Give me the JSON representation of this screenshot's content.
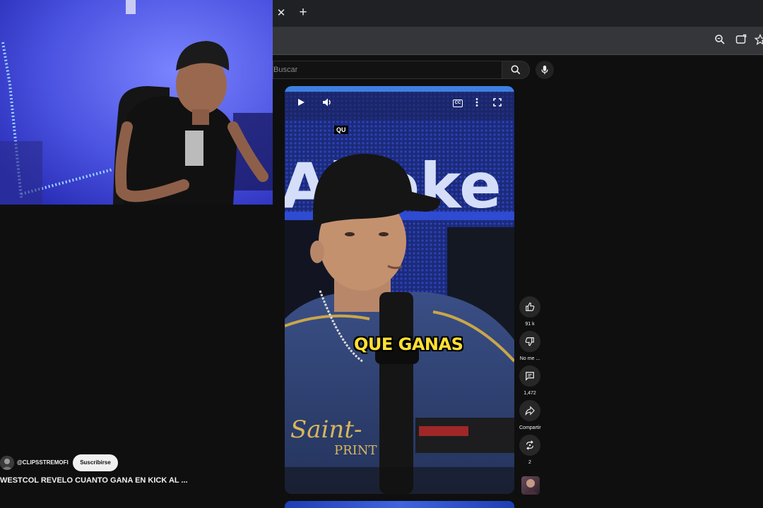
{
  "browser": {
    "tab_close_glyph": "✕",
    "new_tab_glyph": "+"
  },
  "search": {
    "placeholder": "Buscar"
  },
  "short": {
    "top_overlay_text": "QU",
    "caption": "QUE GANAS"
  },
  "actions": {
    "like_count": "91 k",
    "dislike_label": "No me ...",
    "comment_count": "1,472",
    "share_label": "Compartir",
    "remix_count": "2"
  },
  "channel": {
    "name": "@CLIPSSTREMOFI",
    "subscribe_label": "Suscribirse"
  },
  "video": {
    "title": "WESTCOL REVELO CUANTO GANA EN KICK AL ..."
  },
  "colors": {
    "background": "#0f0f0f",
    "caption_yellow": "#ffe033",
    "webcam_blue": "#4d58e6"
  }
}
